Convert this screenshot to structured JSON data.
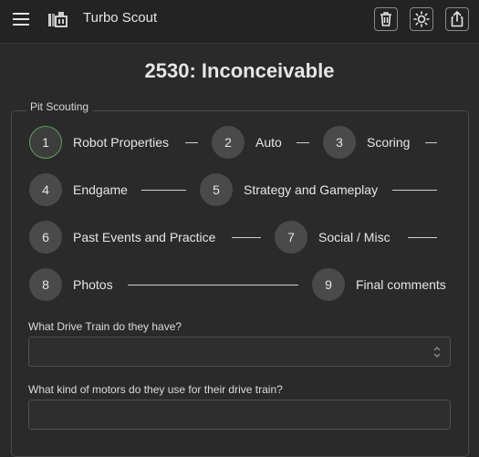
{
  "app": {
    "title": "Turbo Scout",
    "icons": {
      "menu": "hamburger-menu-icon",
      "logo": "turbo-scout-logo-icon",
      "delete": "trash-icon",
      "theme": "sun-icon",
      "share": "share-icon"
    }
  },
  "page": {
    "team_title": "2530: Inconceivable",
    "section_legend": "Pit Scouting"
  },
  "steps": [
    {
      "number": "1",
      "label": "Robot Properties",
      "active": true
    },
    {
      "number": "2",
      "label": "Auto",
      "active": false
    },
    {
      "number": "3",
      "label": "Scoring",
      "active": false
    },
    {
      "number": "4",
      "label": "Endgame",
      "active": false
    },
    {
      "number": "5",
      "label": "Strategy and Gameplay",
      "active": false
    },
    {
      "number": "6",
      "label": "Past Events and Practice",
      "active": false
    },
    {
      "number": "7",
      "label": "Social / Misc",
      "active": false
    },
    {
      "number": "8",
      "label": "Photos",
      "active": false
    },
    {
      "number": "9",
      "label": "Final comments",
      "active": false
    }
  ],
  "questions": [
    {
      "label": "What Drive Train do they have?",
      "value": ""
    },
    {
      "label": "What kind of motors do they use for their drive train?",
      "value": ""
    }
  ],
  "colors": {
    "active_step_border": "#58a05a",
    "background": "#2a2a2a",
    "appbar": "#232323"
  }
}
